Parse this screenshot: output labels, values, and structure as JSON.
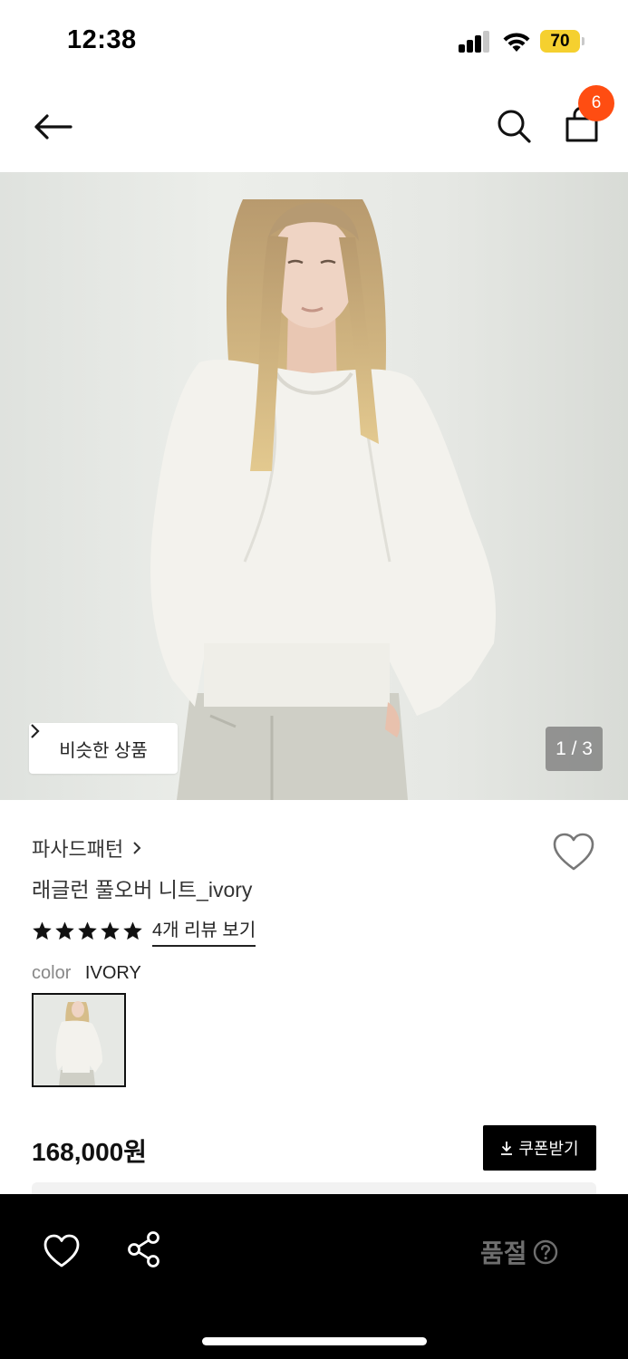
{
  "status_bar": {
    "time": "12:38",
    "battery": "70",
    "signal_bars_active": 3,
    "signal_bars_total": 4
  },
  "nav": {
    "cart_count": "6",
    "icons": [
      "back-arrow-icon",
      "search-icon",
      "shopping-bag-icon"
    ]
  },
  "hero": {
    "similar_label": "비슷한 상품",
    "page_indicator": "1 / 3"
  },
  "product": {
    "brand": "파사드패턴",
    "name": "래글런 풀오버 니트_ivory",
    "rating_stars": 5,
    "review_link": "4개 리뷰 보기",
    "color_label": "color",
    "color_value": "IVORY",
    "price": "168,000원",
    "coupon_label": "쿠폰받기"
  },
  "bottom_bar": {
    "soldout_label": "품절"
  },
  "colors": {
    "badge": "#ff4d12",
    "battery": "#f5d02f",
    "bottom_bar": "#000000",
    "soldout_text": "#6e6e6e"
  }
}
